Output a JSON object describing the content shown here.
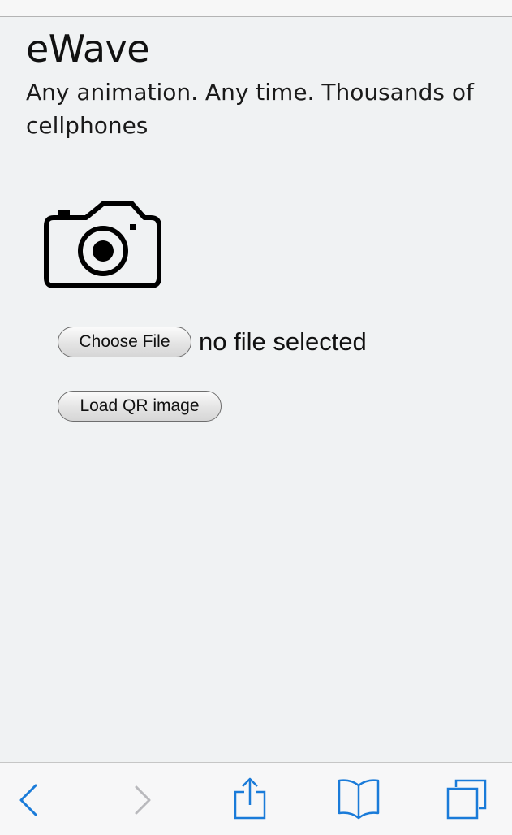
{
  "page": {
    "title": "eWave",
    "tagline": "Any animation. Any time. Thousands of cellphones"
  },
  "file_input": {
    "button_label": "Choose File",
    "status": "no file selected"
  },
  "load_qr": {
    "label": "Load QR image"
  },
  "toolbar": {
    "items": [
      {
        "icon": "back-icon",
        "enabled": true
      },
      {
        "icon": "forward-icon",
        "enabled": false
      },
      {
        "icon": "share-icon",
        "enabled": true
      },
      {
        "icon": "bookmarks-icon",
        "enabled": true
      },
      {
        "icon": "tabs-icon",
        "enabled": true
      }
    ],
    "accent_color": "#1a7bd9",
    "disabled_color": "#b9b9bd"
  },
  "colors": {
    "page_background": "#f0f2f3",
    "text": "#111111"
  }
}
